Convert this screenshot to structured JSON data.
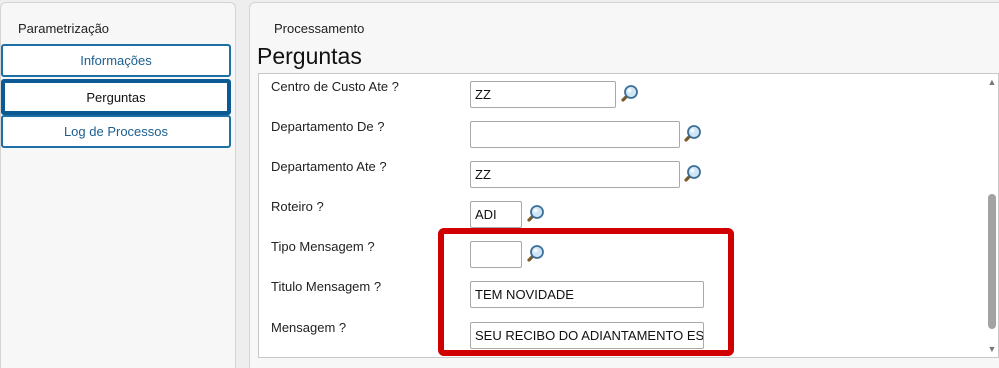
{
  "sidebar": {
    "title": "Parametrização",
    "items": [
      {
        "label": "Informações",
        "active": false
      },
      {
        "label": "Perguntas",
        "active": true
      },
      {
        "label": "Log de Processos",
        "active": false
      }
    ]
  },
  "main": {
    "section": "Processamento",
    "title": "Perguntas",
    "fields": [
      {
        "label": "Centro de Custo Ate ?",
        "value": "ZZ"
      },
      {
        "label": "Departamento De ?",
        "value": ""
      },
      {
        "label": "Departamento Ate ?",
        "value": "ZZ"
      },
      {
        "label": "Roteiro ?",
        "value": "ADI"
      },
      {
        "label": "Tipo Mensagem ?",
        "value": ""
      },
      {
        "label": "Titulo Mensagem ?",
        "value": "TEM NOVIDADE"
      },
      {
        "label": "Mensagem ?",
        "value": "SEU RECIBO DO ADIANTAMENTO ES"
      }
    ]
  },
  "icons": {
    "lookup": "magnifier-icon",
    "scroll_up": "scroll-up-arrow-icon",
    "scroll_down": "scroll-down-arrow-icon"
  },
  "colors": {
    "nav_border": "#1d6fa5",
    "nav_text": "#1a5f91",
    "highlight": "#d10000"
  }
}
